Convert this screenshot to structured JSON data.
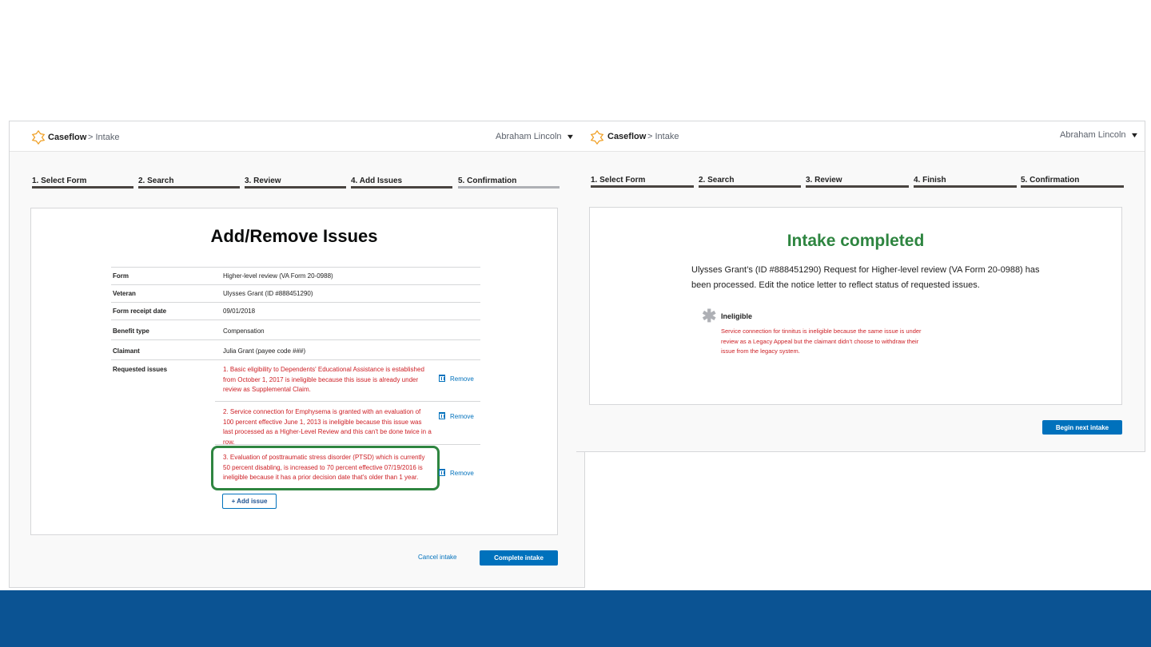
{
  "left": {
    "header": {
      "brand": "Caseflow",
      "crumb": "> Intake",
      "user": "Abraham Lincoln"
    },
    "steps": [
      "1. Select Form",
      "2. Search",
      "3. Review",
      "4. Add Issues",
      "5. Confirmation"
    ],
    "title": "Add/Remove Issues",
    "fields": [
      {
        "label": "Form",
        "value": "Higher-level review (VA Form 20-0988)"
      },
      {
        "label": "Veteran",
        "value": "Ulysses Grant (ID #888451290)"
      },
      {
        "label": "Form receipt date",
        "value": "09/01/2018"
      },
      {
        "label": "Benefit type",
        "value": "Compensation"
      },
      {
        "label": "Claimant",
        "value": "Julia Grant (payee code ###)"
      },
      {
        "label": "Requested issues",
        "value": ""
      }
    ],
    "issues": [
      "1. Basic eligibility to Dependents' Educational Assistance is established from October 1, 2017 is ineligible because this issue is already under review as Supplemental Claim.",
      "2. Service connection for Emphysema is granted with an evaluation of 100 percent effective June 1, 2013 is ineligible because this issue was last processed as a Higher-Level Review and this can't be done twice in a row.",
      "3. Evaluation of posttraumatic stress disorder (PTSD) which is currently 50 percent disabling, is increased to 70 percent effective 07/19/2016 is ineligible because it has a prior decision date that's older than 1 year."
    ],
    "remove_label": "Remove",
    "add_issue_label": "+ Add issue",
    "cancel_label": "Cancel intake",
    "complete_label": "Complete intake"
  },
  "right": {
    "header": {
      "brand": "Caseflow",
      "crumb": "> Intake",
      "user": "Abraham Lincoln"
    },
    "steps": [
      "1. Select Form",
      "2. Search",
      "3. Review",
      "4. Finish",
      "5. Confirmation"
    ],
    "title": "Intake completed",
    "message": "Ulysses Grant’s (ID #888451290) Request for Higher-level review (VA Form 20-0988) has been processed. Edit the notice letter to reflect status of requested issues.",
    "ineligible_title": "Ineligible",
    "ineligible_text": "Service connection for tinnitus is ineligible because the same issue is under review as a Legacy Appeal but the claimant didn’t choose to withdraw their issue from the legacy system.",
    "next_label": "Begin next intake"
  },
  "colors": {
    "accent_blue": "#0071bc",
    "success_green": "#2e8540",
    "error_red": "#cd2026",
    "footer_blue": "#0b5393",
    "logo_orange": "#f0a026"
  }
}
